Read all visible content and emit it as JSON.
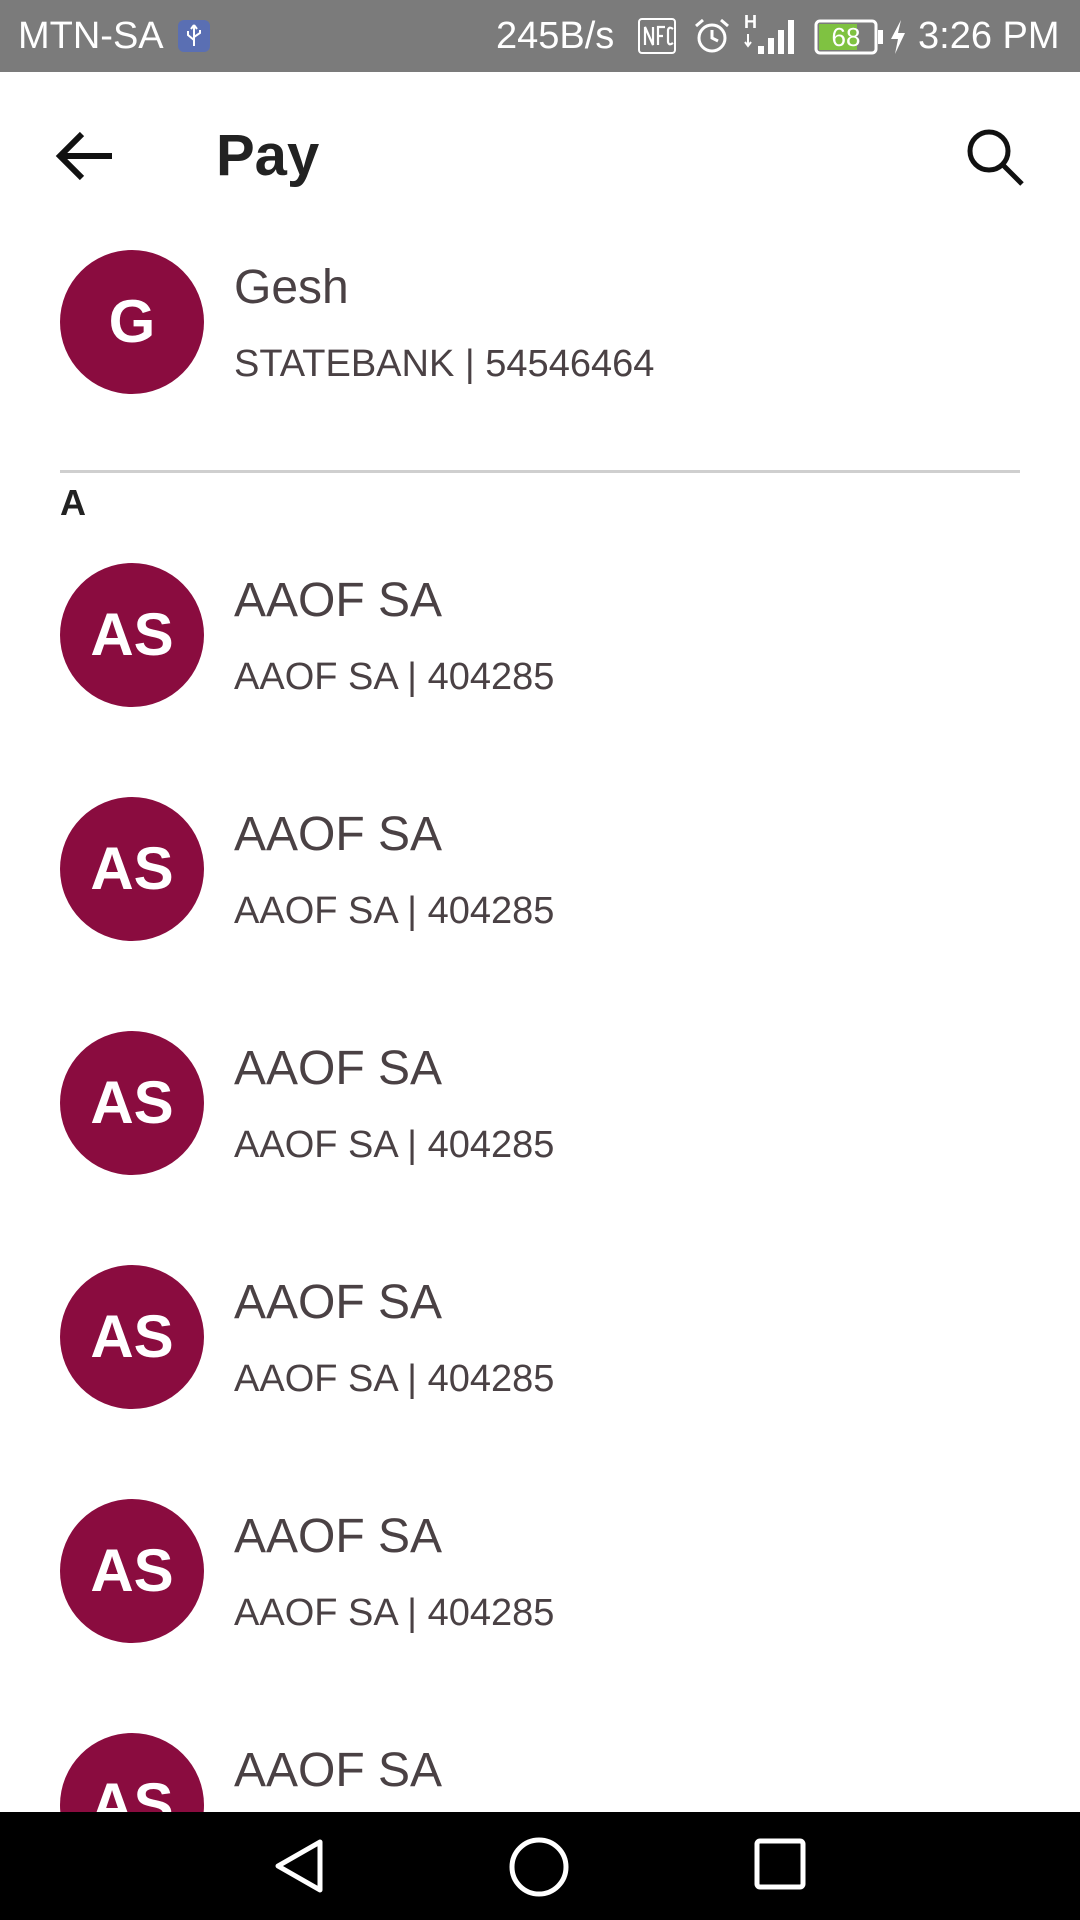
{
  "status_bar": {
    "carrier": "MTN-SA",
    "network_speed": "245B/s",
    "network_type": "H",
    "battery_level": "68",
    "time": "3:26 PM",
    "icons": [
      "usb-icon",
      "nfc-icon",
      "alarm-icon",
      "signal-icon",
      "battery-icon",
      "charging-icon"
    ]
  },
  "header": {
    "title": "Pay",
    "icons": [
      "back-arrow-icon",
      "search-icon"
    ]
  },
  "colors": {
    "avatar": "#8a0c3f",
    "status_bar": "#7b7b7b",
    "text": "#4a4144",
    "battery_fill": "#7fc241"
  },
  "recent": {
    "initials": "G",
    "name": "Gesh",
    "detail": "STATEBANK | 54546464"
  },
  "section": {
    "letter": "A",
    "items": [
      {
        "initials": "AS",
        "name": "AAOF SA",
        "detail": "AAOF SA | 404285"
      },
      {
        "initials": "AS",
        "name": "AAOF SA",
        "detail": "AAOF SA | 404285"
      },
      {
        "initials": "AS",
        "name": "AAOF SA",
        "detail": "AAOF SA | 404285"
      },
      {
        "initials": "AS",
        "name": "AAOF SA",
        "detail": "AAOF SA | 404285"
      },
      {
        "initials": "AS",
        "name": "AAOF SA",
        "detail": "AAOF SA | 404285"
      },
      {
        "initials": "AS",
        "name": "AAOF SA",
        "detail": ""
      }
    ]
  },
  "nav_bar": {
    "icons": [
      "nav-back-icon",
      "nav-home-icon",
      "nav-recents-icon"
    ]
  }
}
